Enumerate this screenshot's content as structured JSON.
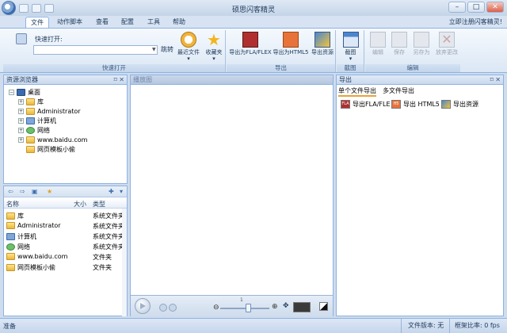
{
  "app": {
    "title": "硕思闪客精灵"
  },
  "window_buttons": [
    "–",
    "□",
    "✕"
  ],
  "menu": {
    "tabs": [
      {
        "label": "文件",
        "active": true
      },
      {
        "label": "动作脚本",
        "active": false
      },
      {
        "label": "查看",
        "active": false
      },
      {
        "label": "配置",
        "active": false
      },
      {
        "label": "工具",
        "active": false
      },
      {
        "label": "帮助",
        "active": false
      }
    ],
    "register_link": "立即注册闪客精灵!"
  },
  "ribbon": {
    "quick_open": {
      "label": "快速打开:",
      "combo_value": "",
      "go_label": "跳转",
      "recent_label": "最近文件",
      "favorites_label": "收藏夹",
      "group_label": "快速打开"
    },
    "export": {
      "fla_label": "导出为FLA/FLEX",
      "html5_label": "导出为HTML5",
      "resources_label": "导出资源",
      "group_label": "导出"
    },
    "screenshot": {
      "label": "截图",
      "group_label": "截图"
    },
    "edit": {
      "edit_label": "编辑",
      "save_label": "保存",
      "save_as_label": "另存为",
      "discard_label": "放弃更改",
      "group_label": "编辑"
    }
  },
  "resource_browser": {
    "title": "资源浏览器",
    "tree": [
      {
        "label": "桌面",
        "icon": "desktop-icon"
      },
      {
        "label": "库",
        "icon": "library-icon"
      },
      {
        "label": "Administrator",
        "icon": "user-folder-icon"
      },
      {
        "label": "计算机",
        "icon": "computer-icon"
      },
      {
        "label": "网络",
        "icon": "network-icon"
      },
      {
        "label": "www.baidu.com",
        "icon": "folder-icon"
      },
      {
        "label": "网页模板小偷",
        "icon": "folder-icon"
      }
    ]
  },
  "file_list": {
    "columns": {
      "name": "名称",
      "size": "大小",
      "type": "类型"
    },
    "rows": [
      {
        "name": "库",
        "type": "系统文件夹"
      },
      {
        "name": "Administrator",
        "type": "系统文件夹"
      },
      {
        "name": "计算机",
        "type": "系统文件夹"
      },
      {
        "name": "网络",
        "type": "系统文件夹"
      },
      {
        "name": "www.baidu.com",
        "type": "文件夹"
      },
      {
        "name": "网页模板小偷",
        "type": "文件夹"
      }
    ]
  },
  "preview": {
    "title": "播放图",
    "zoom_tick": "1"
  },
  "export_panel": {
    "title": "导出",
    "tabs": [
      {
        "label": "单个文件导出",
        "active": true
      },
      {
        "label": "多文件导出",
        "active": false
      }
    ],
    "buttons": [
      {
        "label": "导出FLA/FLE",
        "tag": "FLA"
      },
      {
        "label": "导出 HTML5",
        "tag": "H5"
      },
      {
        "label": "导出资源",
        "tag": ""
      }
    ]
  },
  "status": {
    "left": "准备",
    "version": "文件版本: 无",
    "fps": "框架比率: 0 fps"
  },
  "colors": {
    "accent": "#8db2e3",
    "ribbon_bg": "#dbe7f5",
    "tab_highlight": "#e9a23a"
  }
}
